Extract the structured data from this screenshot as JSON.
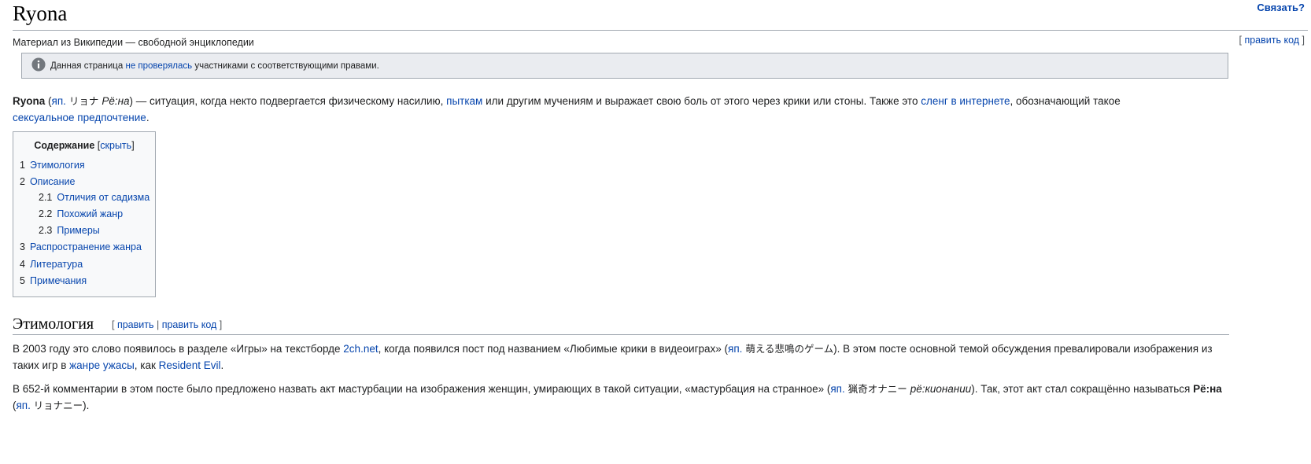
{
  "header": {
    "title": "Ryona",
    "lang_link": "Связать?",
    "tagline": "Материал из Википедии — свободной энциклопедии",
    "edit_code": "править код"
  },
  "notice": {
    "icon": "info-icon",
    "pre": "Данная страница ",
    "link": "не проверялась",
    "post": " участниками с соответствующими правами."
  },
  "intro": {
    "bold": "Ryona",
    "p1": " (",
    "jp_abbr": "яп.",
    "jp_kana": " リョナ ",
    "jp_reading": "Рё:на",
    "p2": ") — ситуация, когда некто подвергается физическому насилию, ",
    "link_torture": "пыткам",
    "p3": " или другим мучениям и выражает свою боль от этого через крики или стоны. Также это ",
    "link_slang": "сленг в интернете",
    "p4": ", обозначающий такое ",
    "link_sexual": "сексуальное предпочтение",
    "p5": "."
  },
  "toc": {
    "title": "Содержание",
    "hide": "скрыть",
    "items": [
      {
        "num": "1",
        "label": "Этимология"
      },
      {
        "num": "2",
        "label": "Описание"
      },
      {
        "num": "2.1",
        "label": "Отличия от садизма"
      },
      {
        "num": "2.2",
        "label": "Похожий жанр"
      },
      {
        "num": "2.3",
        "label": "Примеры"
      },
      {
        "num": "3",
        "label": "Распространение жанра"
      },
      {
        "num": "4",
        "label": "Литература"
      },
      {
        "num": "5",
        "label": "Примечания"
      }
    ]
  },
  "section": {
    "title": "Этимология",
    "edit": "править",
    "edit_code": "править код"
  },
  "etym1": {
    "t1": "В 2003 году это слово появилось в разделе «Игры» на текстборде ",
    "link_2ch": "2ch.net",
    "t2": ", когда появился пост под названием «Любимые крики в видеоиграх» (",
    "jp_abbr": "яп.",
    "jp_text": " 萌える悲鳴のゲーム",
    "t3": "). В этом посте основной темой обсуждения превалировали изображения из таких игр в ",
    "link_horror": "жанре ужасы",
    "t4": ", как ",
    "link_re": "Resident Evil",
    "t5": "."
  },
  "etym2": {
    "t1": "В 652-й комментарии в этом посте было предложено назвать акт мастурбации на изображения женщин, умирающих в такой ситуации, «мастурбация на странное» (",
    "jp_abbr": "яп.",
    "jp_text": " 猟奇オナニー ",
    "jp_reading": "рё:кионании",
    "t2": "). Так, этот акт стал сокращённо называться ",
    "bold": "Рё:на",
    "t3": " (",
    "jp_abbr2": "яп.",
    "jp_text2": "リョナニー",
    "t4": ")."
  }
}
